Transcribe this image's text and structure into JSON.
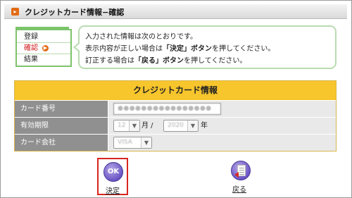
{
  "header": {
    "icon": "arrow-right-icon",
    "title": "クレジットカード情報−確認"
  },
  "steps": [
    {
      "label": "登録",
      "active": false
    },
    {
      "label": "確認",
      "active": true,
      "icon": "arrow-right-circle-icon"
    },
    {
      "label": "結果",
      "active": false
    }
  ],
  "message": {
    "line1": "入力された情報は次のとおりです。",
    "line2_prefix": "表示内容が正しい場合は",
    "line2_bold": "「決定」ボタン",
    "line2_suffix": "を押してください。",
    "line3_prefix": "訂正する場合は",
    "line3_bold": "「戻る」ボタン",
    "line3_suffix": "を押してください。"
  },
  "card_section": {
    "title": "クレジットカード情報",
    "card_number_label": "カード番号",
    "card_number_value": "●●●●●●●●●●●●●●●●",
    "expiry_label": "有効期限",
    "month_value": "12",
    "month_unit": "月 /",
    "year_value": "2020",
    "year_unit": "年",
    "company_label": "カード会社",
    "company_value": "VISA"
  },
  "buttons": {
    "ok_icon_text": "OK",
    "ok_label": "決定",
    "back_label": "戻る"
  },
  "colors": {
    "accent": "#f7c52c",
    "step_border": "#7cc46a",
    "active_step": "#d0191b",
    "ok_highlight": "#d7261f"
  }
}
